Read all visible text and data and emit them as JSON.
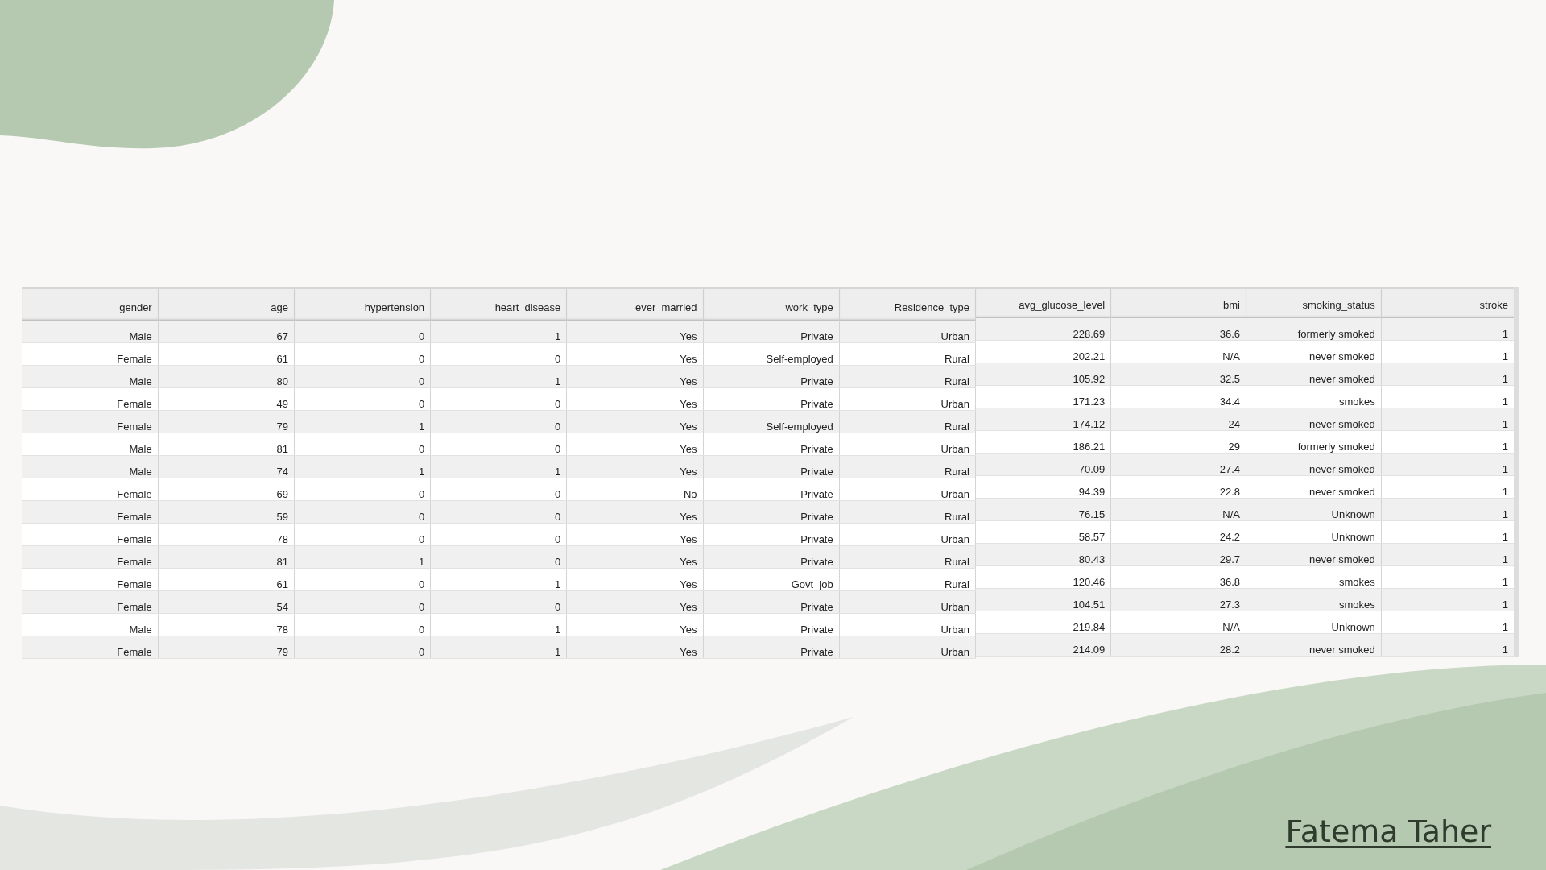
{
  "left_table": {
    "columns": [
      "gender",
      "age",
      "hypertension",
      "heart_disease",
      "ever_married",
      "work_type",
      "Residence_type"
    ],
    "rows": [
      [
        "Male",
        "67",
        "0",
        "1",
        "Yes",
        "Private",
        "Urban"
      ],
      [
        "Female",
        "61",
        "0",
        "0",
        "Yes",
        "Self-employed",
        "Rural"
      ],
      [
        "Male",
        "80",
        "0",
        "1",
        "Yes",
        "Private",
        "Rural"
      ],
      [
        "Female",
        "49",
        "0",
        "0",
        "Yes",
        "Private",
        "Urban"
      ],
      [
        "Female",
        "79",
        "1",
        "0",
        "Yes",
        "Self-employed",
        "Rural"
      ],
      [
        "Male",
        "81",
        "0",
        "0",
        "Yes",
        "Private",
        "Urban"
      ],
      [
        "Male",
        "74",
        "1",
        "1",
        "Yes",
        "Private",
        "Rural"
      ],
      [
        "Female",
        "69",
        "0",
        "0",
        "No",
        "Private",
        "Urban"
      ],
      [
        "Female",
        "59",
        "0",
        "0",
        "Yes",
        "Private",
        "Rural"
      ],
      [
        "Female",
        "78",
        "0",
        "0",
        "Yes",
        "Private",
        "Urban"
      ],
      [
        "Female",
        "81",
        "1",
        "0",
        "Yes",
        "Private",
        "Rural"
      ],
      [
        "Female",
        "61",
        "0",
        "1",
        "Yes",
        "Govt_job",
        "Rural"
      ],
      [
        "Female",
        "54",
        "0",
        "0",
        "Yes",
        "Private",
        "Urban"
      ],
      [
        "Male",
        "78",
        "0",
        "1",
        "Yes",
        "Private",
        "Urban"
      ],
      [
        "Female",
        "79",
        "0",
        "1",
        "Yes",
        "Private",
        "Urban"
      ]
    ]
  },
  "right_table": {
    "columns": [
      "avg_glucose_level",
      "bmi",
      "smoking_status",
      "stroke"
    ],
    "rows": [
      [
        "228.69",
        "36.6",
        "formerly smoked",
        "1"
      ],
      [
        "202.21",
        "N/A",
        "never smoked",
        "1"
      ],
      [
        "105.92",
        "32.5",
        "never smoked",
        "1"
      ],
      [
        "171.23",
        "34.4",
        "smokes",
        "1"
      ],
      [
        "174.12",
        "24",
        "never smoked",
        "1"
      ],
      [
        "186.21",
        "29",
        "formerly smoked",
        "1"
      ],
      [
        "70.09",
        "27.4",
        "never smoked",
        "1"
      ],
      [
        "94.39",
        "22.8",
        "never smoked",
        "1"
      ],
      [
        "76.15",
        "N/A",
        "Unknown",
        "1"
      ],
      [
        "58.57",
        "24.2",
        "Unknown",
        "1"
      ],
      [
        "80.43",
        "29.7",
        "never smoked",
        "1"
      ],
      [
        "120.46",
        "36.8",
        "smokes",
        "1"
      ],
      [
        "104.51",
        "27.3",
        "smokes",
        "1"
      ],
      [
        "219.84",
        "N/A",
        "Unknown",
        "1"
      ],
      [
        "214.09",
        "28.2",
        "never smoked",
        "1"
      ]
    ]
  },
  "author": "Fatema Taher"
}
